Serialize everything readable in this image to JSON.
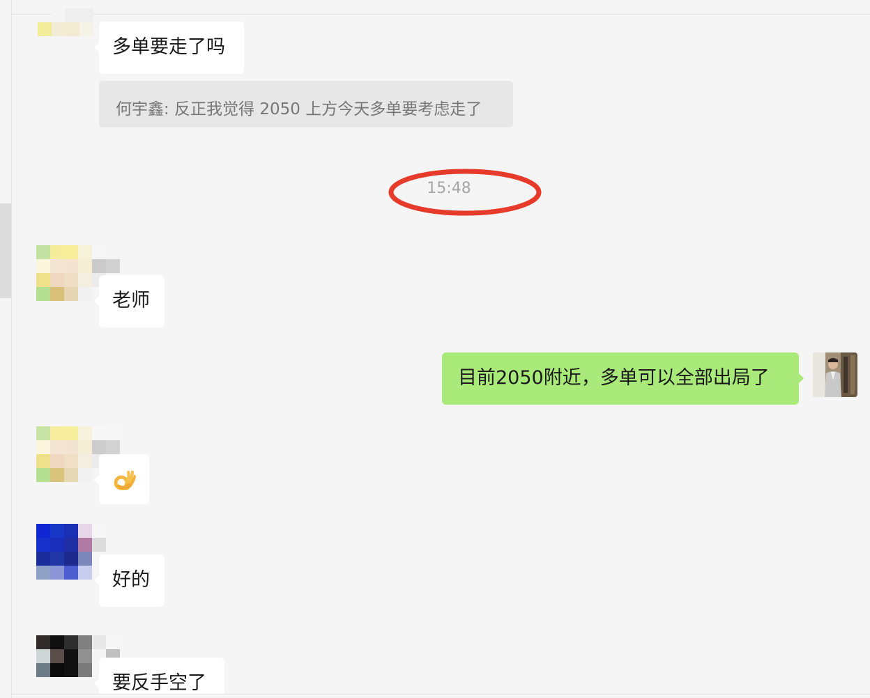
{
  "messages": [
    {
      "sender": "other",
      "text": "多单要走了吗"
    },
    {
      "quote": "何宇鑫: 反正我觉得 2050 上方今天多单要考虑走了"
    },
    {
      "time": "15:48"
    },
    {
      "sender": "other",
      "text": "老师"
    },
    {
      "sender": "self",
      "text": "目前2050附近，多单可以全部出局了"
    },
    {
      "sender": "other",
      "emoji": "ok-hand-icon"
    },
    {
      "sender": "other",
      "text": "好的"
    },
    {
      "sender": "other",
      "text": "要反手空了"
    }
  ],
  "colors": {
    "background": "#f5f5f5",
    "bubble_other": "#ffffff",
    "bubble_self": "#a9ea7a",
    "quote_bg": "#e7e7e7",
    "annotation": "#e63a2a"
  },
  "avatars": {
    "top_partial": [
      [
        null,
        "#f5f5f5",
        "#eeeeee",
        "#eeeeee",
        null,
        null
      ],
      [
        "#f2ec9b",
        "#f3ecd5",
        "#f3ead2",
        "#f5f3e6",
        null,
        null
      ]
    ],
    "member_a": [
      [
        "#c3e1a0",
        "#f5ec9c",
        "#f7ed9b",
        "#f6f1d9",
        "#f6f6f6",
        "#f4f4f4"
      ],
      [
        "#fbf5db",
        "#f4e4d2",
        "#f3e3d0",
        "#f5eed5",
        "#cbcbcb",
        "#d1d1d1"
      ],
      [
        "#efe08a",
        "#efd8c0",
        "#f0dec4",
        "#f3eedf",
        "#ebebeb",
        null
      ],
      [
        "#b4df90",
        "#d8c07a",
        "#e6d7b2",
        "#f1f1f1",
        null,
        null
      ],
      [
        null,
        null,
        null,
        null,
        null,
        null
      ],
      [
        null,
        null,
        null,
        null,
        null,
        null
      ]
    ],
    "member_b": [
      [
        "#c7e3a5",
        "#f6ed9f",
        "#f7ef9e",
        "#f6f1db",
        "#f7f7f7",
        "#f6f6f6"
      ],
      [
        "#fbf6dd",
        "#f4e4d3",
        "#f3e3d1",
        "#f5eed6",
        "#cccccc",
        "#d2d2d2"
      ],
      [
        "#efe08c",
        "#efd8c1",
        "#f0dec5",
        "#f3eee0",
        "#ececec",
        null
      ],
      [
        "#b5e092",
        "#d8c27c",
        "#e6d8b3",
        "#f1f1f1",
        null,
        null
      ]
    ],
    "member_c": [
      [
        "#1127d6",
        "#1839c8",
        "#1a2fb4",
        "#e6d6e8",
        "#f6f6f6",
        null
      ],
      [
        "#1631cb",
        "#192fbc",
        "#1f2ea5",
        "#b07aa5",
        "#dcdcdc",
        null
      ],
      [
        "#1b2d9c",
        "#2137a6",
        "#1f2a8e",
        "#7e87b9",
        null,
        null
      ],
      [
        "#8ea0c5",
        "#8b96d6",
        "#4d5ed0",
        "#c6cdef",
        null,
        null
      ]
    ],
    "member_d": [
      [
        "#312a2a",
        "#0f0f10",
        "#2e2e2e",
        "#808080",
        "#e8e8e8",
        "#f6f6f6"
      ],
      [
        "#cfd6d6",
        "#5a4d4a",
        "#111111",
        "#909090",
        null,
        "#c0c0c0"
      ],
      [
        "#6c7c86",
        "#0b0b0b",
        "#121212",
        "#7a7a7a",
        null,
        null
      ]
    ]
  }
}
